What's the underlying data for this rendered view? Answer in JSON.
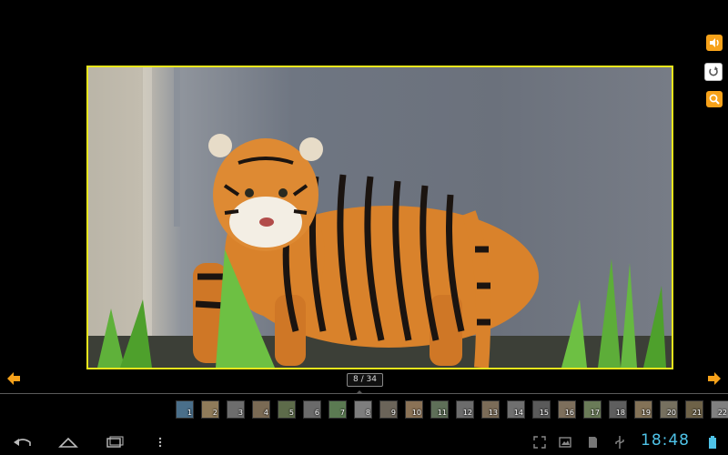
{
  "toolbar": {
    "sound_icon": "speaker-icon",
    "rotate_icon": "rotate-icon",
    "zoom_icon": "zoom-icon"
  },
  "viewer": {
    "counter": "8 / 34",
    "prev_icon": "arrow-left-icon",
    "next_icon": "arrow-right-icon",
    "frame_color": "#e8e61c",
    "accent_color": "#f7a21a"
  },
  "filmstrip": {
    "thumbnails": [
      "1",
      "2",
      "3",
      "4",
      "5",
      "6",
      "7",
      "8",
      "9",
      "10",
      "11",
      "12",
      "13",
      "14",
      "15",
      "16",
      "17",
      "18",
      "19",
      "20",
      "21",
      "22"
    ]
  },
  "status_bar": {
    "time": "18:48",
    "clock_color": "#4fc3e8"
  }
}
